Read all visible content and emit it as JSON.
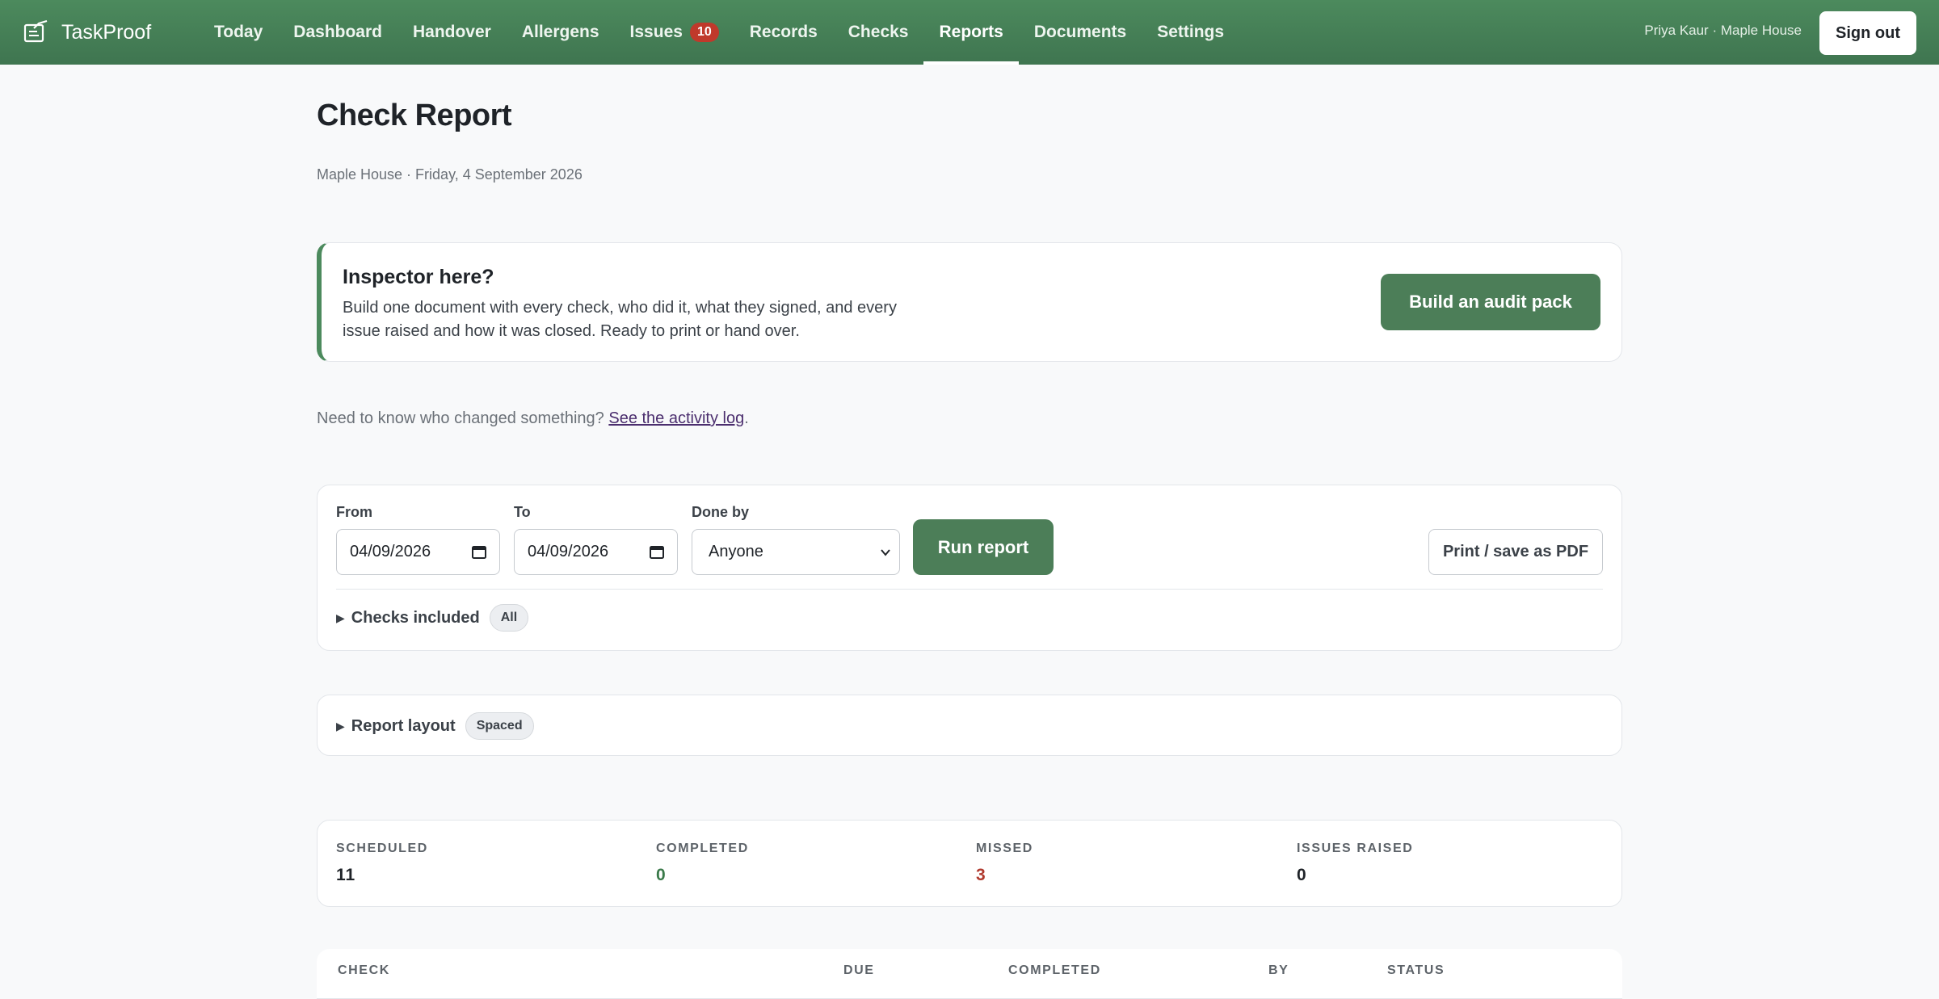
{
  "app": {
    "name": "TaskProof"
  },
  "nav": {
    "items": [
      {
        "label": "Today"
      },
      {
        "label": "Dashboard"
      },
      {
        "label": "Handover"
      },
      {
        "label": "Allergens"
      },
      {
        "label": "Issues",
        "badge": "10"
      },
      {
        "label": "Records"
      },
      {
        "label": "Checks"
      },
      {
        "label": "Reports",
        "active": true
      },
      {
        "label": "Documents"
      },
      {
        "label": "Settings"
      }
    ],
    "user": "Priya Kaur · Maple House",
    "sign_out": "Sign out"
  },
  "page": {
    "title": "Check Report",
    "subtitle": "Maple House · Friday, 4 September 2026"
  },
  "inspector": {
    "title": "Inspector here?",
    "text": "Build one document with every check, who did it, what they signed, and every issue raised and how it was closed. Ready to print or hand over.",
    "button": "Build an audit pack"
  },
  "activity": {
    "prefix": "Need to know who changed something?",
    "link": "See the activity log",
    "suffix": "."
  },
  "filters": {
    "from_label": "From",
    "from_value": "04/09/2026",
    "to_label": "To",
    "to_value": "04/09/2026",
    "done_by_label": "Done by",
    "done_by_value": "Anyone",
    "run_button": "Run report",
    "print_button": "Print / save as PDF",
    "checks_included_label": "Checks included",
    "checks_included_value": "All"
  },
  "layout": {
    "label": "Report layout",
    "value": "Spaced"
  },
  "stats": [
    {
      "label": "SCHEDULED",
      "value": "11",
      "color": "#1f2328"
    },
    {
      "label": "COMPLETED",
      "value": "0",
      "color": "#3a7a4a"
    },
    {
      "label": "MISSED",
      "value": "3",
      "color": "#b03a2e"
    },
    {
      "label": "ISSUES RAISED",
      "value": "0",
      "color": "#1f2328"
    }
  ],
  "table": {
    "columns": [
      "CHECK",
      "DUE",
      "COMPLETED",
      "BY",
      "STATUS"
    ]
  },
  "colors": {
    "brand": "#4c8a5d",
    "button": "#4c7e58",
    "badge": "#c0392b",
    "link": "#4b2e6e"
  }
}
